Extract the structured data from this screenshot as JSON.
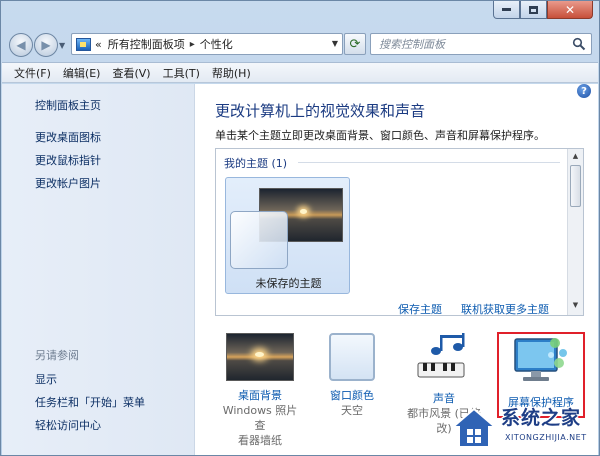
{
  "address_bar": {
    "overflow": "«",
    "crumbs": [
      "所有控制面板项",
      "个性化"
    ],
    "separator": "▸"
  },
  "search": {
    "placeholder": "搜索控制面板"
  },
  "menu": [
    "文件(F)",
    "编辑(E)",
    "查看(V)",
    "工具(T)",
    "帮助(H)"
  ],
  "sidebar": {
    "links": [
      "控制面板主页",
      "更改桌面图标",
      "更改鼠标指针",
      "更改帐户图片"
    ],
    "see_also_header": "另请参阅",
    "see_also": [
      "显示",
      "任务栏和「开始」菜单",
      "轻松访问中心"
    ]
  },
  "main": {
    "title": "更改计算机上的视觉效果和声音",
    "subtitle": "单击某个主题立即更改桌面背景、窗口颜色、声音和屏幕保护程序。",
    "my_themes_header": "我的主题 (1)",
    "unsaved_theme": "未保存的主题",
    "save_theme_link": "保存主题",
    "online_themes_link": "联机获取更多主题"
  },
  "bottom": [
    {
      "label": "桌面背景",
      "sub1": "Windows 照片查",
      "sub2": "看器墙纸"
    },
    {
      "label": "窗口颜色",
      "sub1": "天空",
      "sub2": ""
    },
    {
      "label": "声音",
      "sub1": "都市风景 (已修改)",
      "sub2": ""
    },
    {
      "label": "屏幕保护程序",
      "sub1": "",
      "sub2": ""
    }
  ],
  "watermark": {
    "text": "系统之家",
    "url": "XITONGZHIJIA.NET"
  },
  "colors": {
    "highlight": "#e0202a",
    "link": "#0c5bb0",
    "title": "#1b3b82"
  }
}
